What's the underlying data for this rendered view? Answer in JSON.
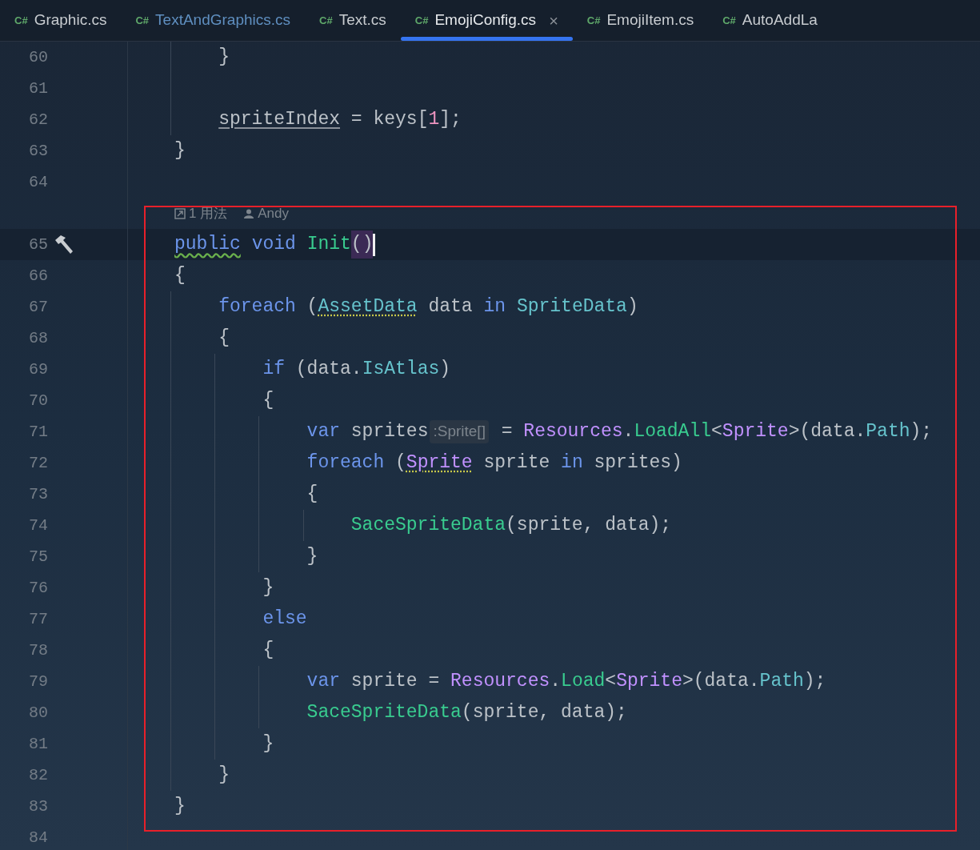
{
  "tabs": [
    {
      "label": "Graphic.cs",
      "badge": "C#",
      "selected": false,
      "modified": false,
      "closable": false
    },
    {
      "label": "TextAndGraphics.cs",
      "badge": "C#",
      "selected": false,
      "modified": true,
      "closable": false
    },
    {
      "label": "Text.cs",
      "badge": "C#",
      "selected": false,
      "modified": false,
      "closable": false
    },
    {
      "label": "EmojiConfig.cs",
      "badge": "C#",
      "selected": true,
      "modified": false,
      "closable": true,
      "close": "×"
    },
    {
      "label": "EmojiItem.cs",
      "badge": "C#",
      "selected": false,
      "modified": false,
      "closable": false
    },
    {
      "label": "AutoAddLa",
      "badge": "C#",
      "selected": false,
      "modified": false,
      "closable": false
    }
  ],
  "lines": [
    {
      "kind": "group",
      "children": [
        {
          "kind": "code",
          "number": "60",
          "tokens": [
            {
              "kind": "plain",
              "t": "}"
            }
          ]
        },
        {
          "kind": "code",
          "number": "61"
        },
        {
          "kind": "code",
          "number": "62",
          "tokens": [
            {
              "kind": "field",
              "t": "spriteIndex",
              "underlined": true
            },
            {
              "kind": "plain",
              "t": " = keys["
            },
            {
              "kind": "number",
              "t": "1"
            },
            {
              "kind": "plain",
              "t": "];"
            }
          ]
        }
      ]
    },
    {
      "kind": "code",
      "number": "63",
      "tokens": [
        {
          "kind": "plain",
          "t": "}"
        }
      ]
    },
    {
      "kind": "code",
      "number": "64"
    },
    {
      "kind": "vision",
      "usages": "1 用法",
      "author": "Andy"
    },
    {
      "kind": "code",
      "number": "65",
      "current": true,
      "gutter_icon": true,
      "caret": true,
      "tokens": [
        {
          "kind": "keyword",
          "t": "public",
          "underlined": true
        },
        {
          "kind": "keyword",
          "t": " void"
        },
        {
          "kind": "method",
          "t": " Init"
        },
        {
          "kind": "plain",
          "t": "()",
          "match": true
        }
      ]
    },
    {
      "kind": "code",
      "number": "66",
      "tokens": [
        {
          "kind": "plain",
          "t": "{"
        }
      ],
      "children": [
        {
          "kind": "code",
          "number": "67",
          "tokens": [
            {
              "kind": "keyword",
              "t": "foreach"
            },
            {
              "kind": "plain",
              "t": " ("
            },
            {
              "kind": "class",
              "t": "AssetData",
              "underlined": true
            },
            {
              "kind": "plain",
              "t": " data "
            },
            {
              "kind": "keyword",
              "t": "in"
            },
            {
              "kind": "class",
              "t": " SpriteData"
            },
            {
              "kind": "plain",
              "t": ")"
            }
          ]
        },
        {
          "kind": "code",
          "number": "68",
          "tokens": [
            {
              "kind": "plain",
              "t": "{"
            }
          ],
          "children": [
            {
              "kind": "code",
              "number": "69",
              "tokens": [
                {
                  "kind": "keyword",
                  "t": "if"
                },
                {
                  "kind": "plain",
                  "t": " (data."
                },
                {
                  "kind": "class",
                  "t": "IsAtlas"
                },
                {
                  "kind": "plain",
                  "t": ")"
                }
              ]
            },
            {
              "kind": "code",
              "number": "70",
              "tokens": [
                {
                  "kind": "plain",
                  "t": "{"
                }
              ],
              "children": [
                {
                  "kind": "code",
                  "number": "71",
                  "tokens": [
                    {
                      "kind": "keyword",
                      "t": "var"
                    },
                    {
                      "kind": "plain",
                      "t": " sprites"
                    },
                    {
                      "kind": "hint",
                      "t": ":Sprite[]"
                    },
                    {
                      "kind": "plain",
                      "t": " = "
                    },
                    {
                      "kind": "type",
                      "t": "Resources"
                    },
                    {
                      "kind": "plain",
                      "t": "."
                    },
                    {
                      "kind": "method",
                      "t": "LoadAll"
                    },
                    {
                      "kind": "plain",
                      "t": "<"
                    },
                    {
                      "kind": "type",
                      "t": "Sprite"
                    },
                    {
                      "kind": "plain",
                      "t": ">(data."
                    },
                    {
                      "kind": "class",
                      "t": "Path"
                    },
                    {
                      "kind": "plain",
                      "t": ");"
                    }
                  ]
                },
                {
                  "kind": "code",
                  "number": "72",
                  "tokens": [
                    {
                      "kind": "keyword",
                      "t": "foreach"
                    },
                    {
                      "kind": "plain",
                      "t": " ("
                    },
                    {
                      "kind": "type",
                      "t": "Sprite",
                      "underlined": true
                    },
                    {
                      "kind": "plain",
                      "t": " sprite "
                    },
                    {
                      "kind": "keyword",
                      "t": "in"
                    },
                    {
                      "kind": "plain",
                      "t": " sprites)"
                    }
                  ]
                },
                {
                  "kind": "code",
                  "number": "73",
                  "tokens": [
                    {
                      "kind": "plain",
                      "t": "{"
                    }
                  ],
                  "children": [
                    {
                      "kind": "code",
                      "number": "74",
                      "tokens": [
                        {
                          "kind": "method",
                          "t": "SaceSpriteData"
                        },
                        {
                          "kind": "plain",
                          "t": "(sprite, data);"
                        }
                      ]
                    }
                  ]
                },
                {
                  "kind": "code",
                  "number": "75",
                  "tokens": [
                    {
                      "kind": "plain",
                      "t": "}"
                    }
                  ]
                }
              ]
            },
            {
              "kind": "code",
              "number": "76",
              "tokens": [
                {
                  "kind": "plain",
                  "t": "}"
                }
              ]
            },
            {
              "kind": "code",
              "number": "77",
              "tokens": [
                {
                  "kind": "keyword",
                  "t": "else"
                }
              ]
            },
            {
              "kind": "code",
              "number": "78",
              "tokens": [
                {
                  "kind": "plain",
                  "t": "{"
                }
              ],
              "children": [
                {
                  "kind": "code",
                  "number": "79",
                  "tokens": [
                    {
                      "kind": "keyword",
                      "t": "var"
                    },
                    {
                      "kind": "plain",
                      "t": " sprite = "
                    },
                    {
                      "kind": "type",
                      "t": "Resources"
                    },
                    {
                      "kind": "plain",
                      "t": "."
                    },
                    {
                      "kind": "method",
                      "t": "Load"
                    },
                    {
                      "kind": "plain",
                      "t": "<"
                    },
                    {
                      "kind": "type",
                      "t": "Sprite"
                    },
                    {
                      "kind": "plain",
                      "t": ">(data."
                    },
                    {
                      "kind": "class",
                      "t": "Path"
                    },
                    {
                      "kind": "plain",
                      "t": ");"
                    }
                  ]
                },
                {
                  "kind": "code",
                  "number": "80",
                  "tokens": [
                    {
                      "kind": "method",
                      "t": "SaceSpriteData"
                    },
                    {
                      "kind": "plain",
                      "t": "(sprite, data);"
                    }
                  ]
                }
              ]
            },
            {
              "kind": "code",
              "number": "81",
              "tokens": [
                {
                  "kind": "plain",
                  "t": "}"
                }
              ]
            }
          ]
        },
        {
          "kind": "code",
          "number": "82",
          "tokens": [
            {
              "kind": "plain",
              "t": "}"
            }
          ]
        }
      ]
    },
    {
      "kind": "code",
      "number": "83",
      "tokens": [
        {
          "kind": "plain",
          "t": "}"
        }
      ]
    },
    {
      "kind": "code",
      "number": "84"
    }
  ],
  "annotation": {
    "shown": true
  }
}
